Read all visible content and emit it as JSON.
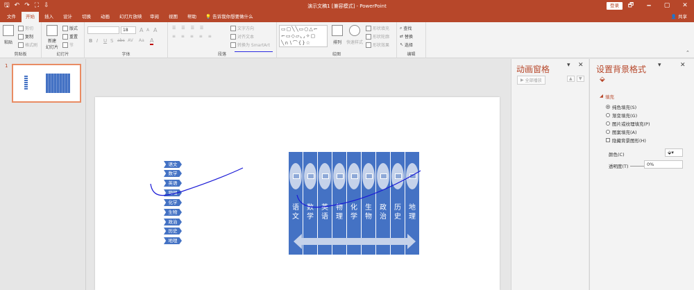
{
  "window": {
    "title": "演示文稿1 [兼容模式] - PowerPoint",
    "login": "登录",
    "min": "🗕",
    "restore": "🗗",
    "max": "▢",
    "close": "✕"
  },
  "qat": {
    "save": "🖫",
    "undo": "↶",
    "redo": "↷",
    "start": "⛶",
    "custom": "⇩"
  },
  "tabs": [
    "文件",
    "开始",
    "插入",
    "设计",
    "切换",
    "动画",
    "幻灯片放映",
    "审阅",
    "视图",
    "帮助"
  ],
  "tellme": "告诉我你想要做什么",
  "share": "共享",
  "ribbon": {
    "clipboard": {
      "label": "剪贴板",
      "paste": "粘贴",
      "cut": "剪切",
      "copy": "复制",
      "format": "格式刷"
    },
    "slides": {
      "label": "幻灯片",
      "new": "新建",
      "new2": "幻灯片",
      "layout": "版式",
      "reset": "重置",
      "section": "节"
    },
    "font": {
      "label": "字体",
      "size": "18",
      "bold": "B",
      "italic": "I",
      "underline": "U",
      "strike": "S",
      "shadow": "abc",
      "spacing": "AV",
      "case": "Aa",
      "color": "A",
      "grow": "A",
      "shrink": "A",
      "clear": "A"
    },
    "paragraph": {
      "label": "段落",
      "textdir": "文字方向",
      "align": "对齐文本",
      "smartart": "转换为 SmartArt"
    },
    "drawing": {
      "label": "绘图",
      "arrange": "排列",
      "styles": "快速样式",
      "fill": "形状填充",
      "outline": "形状轮廓",
      "effects": "形状效果"
    },
    "editing": {
      "label": "编辑",
      "find": "查找",
      "replace": "替换",
      "select": "选择"
    }
  },
  "slidepanel": {
    "number": "1"
  },
  "slide": {
    "tags": [
      "语文",
      "数学",
      "英语",
      "物理",
      "化学",
      "生物",
      "政治",
      "历史",
      "地理"
    ],
    "columns": [
      "语文",
      "数学",
      "英语",
      "物理",
      "化学",
      "生物",
      "政治",
      "历史",
      "地理"
    ]
  },
  "colors": {
    "accent": "#b7472a",
    "shape": "#4472c4",
    "ink": "#1a1ad6"
  },
  "animation_pane": {
    "title": "动画窗格",
    "play": "全部播放",
    "close": "✕"
  },
  "format_pane": {
    "title": "设置背景格式",
    "close": "✕",
    "section": "填充",
    "options": [
      "纯色填充(S)",
      "渐变填充(G)",
      "图片或纹理填充(P)",
      "图案填充(A)"
    ],
    "hide": "隐藏背景图形(H)",
    "color_label": "颜色(C)",
    "transparency_label": "透明度(T)",
    "transparency_value": "0%"
  }
}
